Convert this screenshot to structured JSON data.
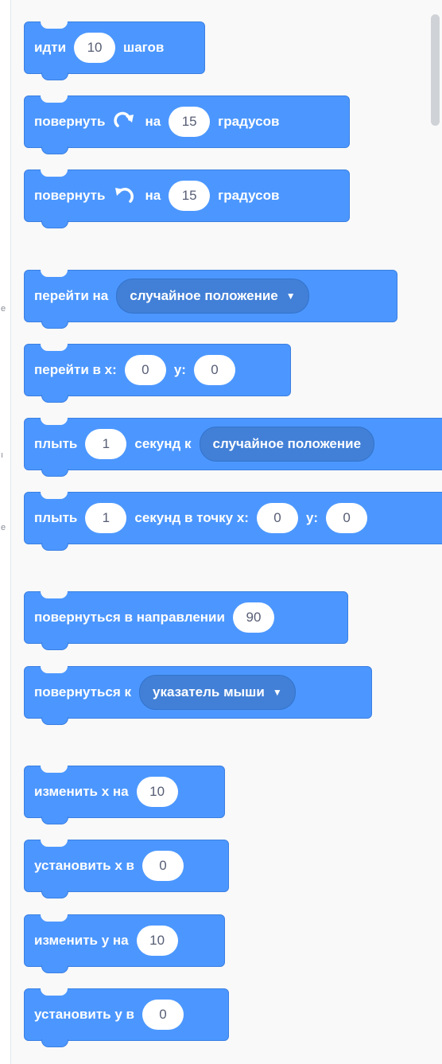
{
  "blocks": {
    "move": {
      "before": "идти",
      "steps": "10",
      "after": "шагов"
    },
    "turn_right": {
      "before": "повернуть",
      "on": "на",
      "degrees": "15",
      "after": "градусов",
      "icon": "rotate-right-icon"
    },
    "turn_left": {
      "before": "повернуть",
      "on": "на",
      "degrees": "15",
      "after": "градусов",
      "icon": "rotate-left-icon"
    },
    "goto_menu": {
      "label": "перейти на",
      "option": "случайное положение"
    },
    "goto_xy": {
      "label": "перейти в x:",
      "x": "0",
      "y_label": "y:",
      "y": "0"
    },
    "glide_menu": {
      "label": "плыть",
      "secs": "1",
      "mid": "секунд к",
      "option": "случайное положение"
    },
    "glide_xy": {
      "label": "плыть",
      "secs": "1",
      "mid": "секунд в точку x:",
      "x": "0",
      "y_label": "y:",
      "y": "0"
    },
    "point_dir": {
      "label": "повернуться в направлении",
      "value": "90"
    },
    "point_towards": {
      "label": "повернуться к",
      "option": "указатель мыши"
    },
    "change_x": {
      "label": "изменить х на",
      "value": "10"
    },
    "set_x": {
      "label": "установить х в",
      "value": "0"
    },
    "change_y": {
      "label": "изменить у на",
      "value": "10"
    },
    "set_y": {
      "label": "установить у в",
      "value": "0"
    }
  },
  "colors": {
    "motion": "#4c97ff",
    "motion_border": "#3a7fe3",
    "dropdown": "#4280d7"
  }
}
